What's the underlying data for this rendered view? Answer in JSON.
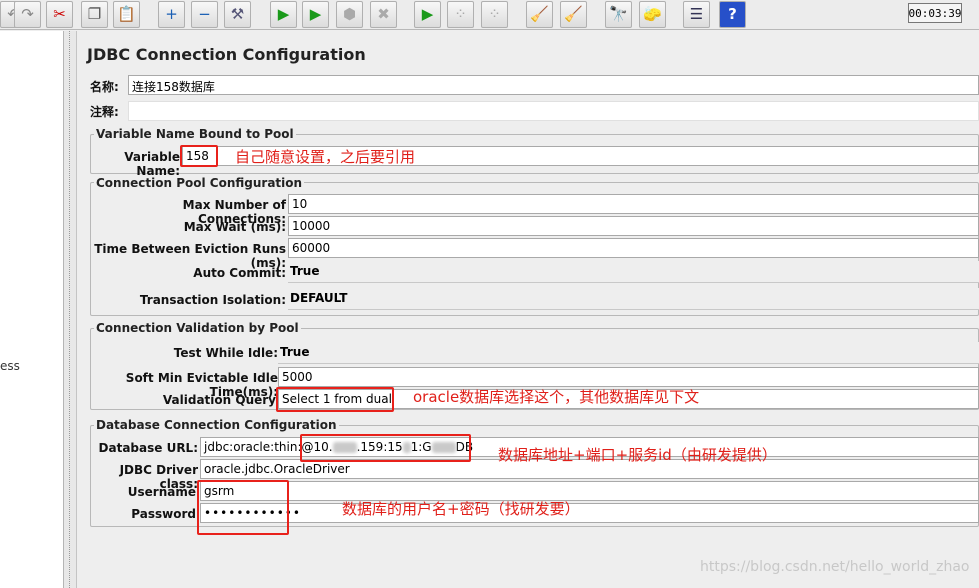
{
  "toolbar": {
    "buttons": [
      {
        "name": "undo-icon",
        "glyph": "↶"
      },
      {
        "name": "redo-icon",
        "glyph": "↷"
      },
      {
        "name": "cut-icon",
        "glyph": "✂"
      },
      {
        "name": "copy-icon",
        "glyph": "❐"
      },
      {
        "name": "paste-icon",
        "glyph": "📋"
      },
      {
        "name": "expand-icon",
        "glyph": "+"
      },
      {
        "name": "collapse-icon",
        "glyph": "−"
      },
      {
        "name": "toggle-icon",
        "glyph": "⚒"
      },
      {
        "name": "start-icon",
        "glyph": "▶"
      },
      {
        "name": "start-no-pauses-icon",
        "glyph": "▶"
      },
      {
        "name": "stop-icon",
        "glyph": "⬢"
      },
      {
        "name": "shutdown-icon",
        "glyph": "✖"
      },
      {
        "name": "remote-start-icon",
        "glyph": "▶"
      },
      {
        "name": "remote-stop-icon",
        "glyph": "⁘"
      },
      {
        "name": "remote-shutdown-icon",
        "glyph": "⁘"
      },
      {
        "name": "clear-icon",
        "glyph": "🧹"
      },
      {
        "name": "clear-all-icon",
        "glyph": "🧹"
      },
      {
        "name": "search-icon",
        "glyph": "🔭"
      },
      {
        "name": "reset-search-icon",
        "glyph": "🧽"
      },
      {
        "name": "function-helper-icon",
        "glyph": "☰"
      },
      {
        "name": "help-icon",
        "glyph": "?"
      }
    ],
    "timer": "00:03:39"
  },
  "tree": {
    "fragment": "ess"
  },
  "title": "JDBC Connection Configuration",
  "name_label": "名称:",
  "name_value": "连接158数据库",
  "comment_label": "注释:",
  "pool_bound": {
    "title": "Variable Name Bound to Pool",
    "variable_label": "Variable Name:",
    "variable_value": "158"
  },
  "pool_config": {
    "title": "Connection Pool Configuration",
    "max_conn_label": "Max Number of Connections:",
    "max_conn_value": "10",
    "max_wait_label": "Max Wait (ms):",
    "max_wait_value": "10000",
    "eviction_label": "Time Between Eviction Runs (ms):",
    "eviction_value": "60000",
    "auto_commit_label": "Auto Commit:",
    "auto_commit_value": "True",
    "isolation_label": "Transaction Isolation:",
    "isolation_value": "DEFAULT"
  },
  "validation": {
    "title": "Connection Validation by Pool",
    "test_idle_label": "Test While Idle:",
    "test_idle_value": "True",
    "soft_min_label": "Soft Min Evictable Idle Time(ms):",
    "soft_min_value": "5000",
    "query_label": "Validation Query",
    "query_value": "Select 1 from dual"
  },
  "db_config": {
    "title": "Database Connection Configuration",
    "url_label": "Database URL:",
    "url_prefix": "jdbc:oracle:thin:@",
    "url_part1": "10.",
    "url_part2": ".159:15",
    "url_part3": "1:G",
    "url_part4": "DB",
    "driver_label": "JDBC Driver class:",
    "driver_value": "oracle.jdbc.OracleDriver",
    "username_label": "Username",
    "username_value": "gsrm",
    "password_label": "Password",
    "password_value": "••••••••••••"
  },
  "annotations": {
    "variable_note": "自己随意设置，之后要引用",
    "query_note": "oracle数据库选择这个，其他数据库见下文",
    "url_note": "数据库地址+端口+服务id（由研发提供）",
    "credentials_note": "数据库的用户名+密码（找研发要）"
  },
  "watermark": "https://blog.csdn.net/hello_world_zhao",
  "colors": {
    "annotation_red": "#e8211b",
    "panel_bg": "#eeeeee"
  }
}
